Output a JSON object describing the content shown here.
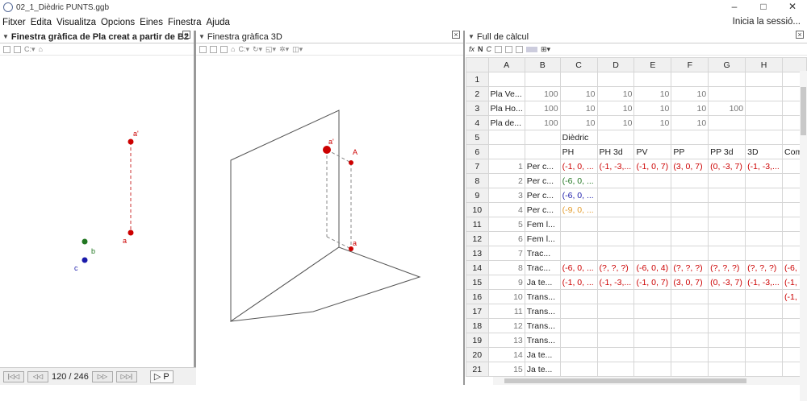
{
  "window": {
    "title": "02_1_Dièdric PUNTS.ggb",
    "minimize": "–",
    "maximize": "□",
    "close": "✕"
  },
  "menu": [
    "Fitxer",
    "Edita",
    "Visualitza",
    "Opcions",
    "Eines",
    "Finestra",
    "Ajuda"
  ],
  "login": "Inicia la sessió...",
  "panel1": {
    "title": "Finestra gràfica de Pla creat a partir de B2",
    "labels": {
      "a1": "a'",
      "a": "a",
      "b": "b",
      "c": "c"
    }
  },
  "panel2": {
    "title": "Finestra gràfica 3D",
    "labels": {
      "a1": "a'",
      "A": "A",
      "a": "a"
    }
  },
  "panel3": {
    "title": "Full de càlcul"
  },
  "footer": {
    "counter": "120 / 246",
    "play": "▷ P"
  },
  "colors": {
    "red": "#cc0000",
    "green": "#227722",
    "blue": "#1a1aaa",
    "orange": "#e39b2a"
  },
  "sheet": {
    "columns": [
      "A",
      "B",
      "C",
      "D",
      "E",
      "F",
      "G",
      "H"
    ],
    "rows": [
      [
        "1",
        "",
        "",
        "",
        "",
        "",
        "",
        "",
        "",
        ""
      ],
      [
        "2",
        "Pla Ve...",
        "100",
        "10",
        "10",
        "10",
        "10",
        "",
        "",
        ""
      ],
      [
        "3",
        "Pla Ho...",
        "100",
        "10",
        "10",
        "10",
        "10",
        "100",
        "",
        ""
      ],
      [
        "4",
        "Pla de...",
        "100",
        "10",
        "10",
        "10",
        "10",
        "",
        "",
        ""
      ],
      [
        "5",
        "",
        "",
        "Dièdric",
        "",
        "",
        "",
        "",
        "",
        ""
      ],
      [
        "6",
        "",
        "",
        "PH",
        "PH 3d",
        "PV",
        "PP",
        "PP 3d",
        "3D",
        "Com"
      ],
      [
        "7",
        "1",
        "Per c...",
        "(-1, 0, ...",
        "(-1, -3,...",
        "(-1, 0, 7)",
        "(3, 0, 7)",
        "(0, -3, 7)",
        "(-1, -3,...",
        ""
      ],
      [
        "8",
        "2",
        "Per c...",
        "(-6, 0, ...",
        "",
        "",
        "",
        "",
        "",
        ""
      ],
      [
        "9",
        "3",
        "Per c...",
        "(-6, 0, ...",
        "",
        "",
        "",
        "",
        "",
        ""
      ],
      [
        "10",
        "4",
        "Per c...",
        "(-9, 0, ...",
        "",
        "",
        "",
        "",
        "",
        ""
      ],
      [
        "11",
        "5",
        "Fem l...",
        "",
        "",
        "",
        "",
        "",
        "",
        ""
      ],
      [
        "12",
        "6",
        "Fem l...",
        "",
        "",
        "",
        "",
        "",
        "",
        ""
      ],
      [
        "13",
        "7",
        "Trac...",
        "",
        "",
        "",
        "",
        "",
        "",
        ""
      ],
      [
        "14",
        "8",
        "Trac...",
        "(-6, 0, ...",
        "(?, ?, ?)",
        "(-6, 0, 4)",
        "(?, ?, ?)",
        "(?, ?, ?)",
        "(?, ?, ?)",
        "(-6,"
      ],
      [
        "15",
        "9",
        "Ja te...",
        "(-1, 0, ...",
        "(-1, -3,...",
        "(-1, 0, 7)",
        "(3, 0, 7)",
        "(0, -3, 7)",
        "(-1, -3,...",
        "(-1,"
      ],
      [
        "16",
        "10",
        "Trans...",
        "",
        "",
        "",
        "",
        "",
        "",
        "(-1,"
      ],
      [
        "17",
        "11",
        "Trans...",
        "",
        "",
        "",
        "",
        "",
        "",
        ""
      ],
      [
        "18",
        "12",
        "Trans...",
        "",
        "",
        "",
        "",
        "",
        "",
        ""
      ],
      [
        "19",
        "13",
        "Trans...",
        "",
        "",
        "",
        "",
        "",
        "",
        ""
      ],
      [
        "20",
        "14",
        "Ja te...",
        "",
        "",
        "",
        "",
        "",
        "",
        ""
      ],
      [
        "21",
        "15",
        "Ja te...",
        "",
        "",
        "",
        "",
        "",
        "",
        ""
      ]
    ]
  }
}
